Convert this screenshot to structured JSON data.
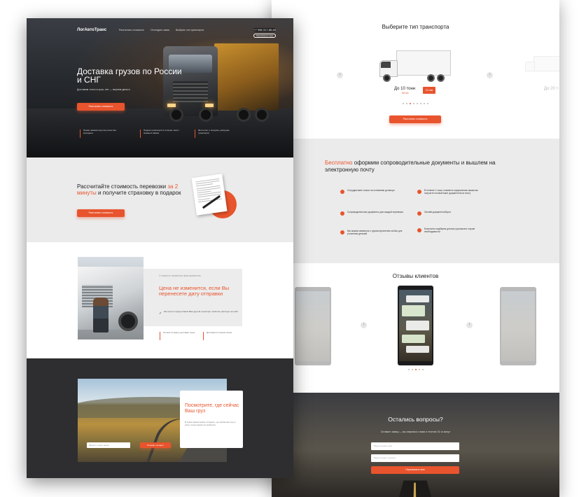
{
  "left_page": {
    "hero": {
      "logo": "ЛогАвтоТранс",
      "nav": [
        "Рассчитать стоимость",
        "Отследить заказ",
        "Выбрать тип транспорта"
      ],
      "phone": "+7 958 317-85-60",
      "callback": "Перезвоните мне",
      "title": "Доставка грузов по России и СНГ",
      "subtitle": "Доставим точно в срок, нет — вернем деньги",
      "cta": "Рассчитать стоимость",
      "features": [
        "Прием заказов круглосуточно без выходных",
        "Подача транспорта в течение часа с момента заказа",
        "Фотоотчет о погрузке, разгрузке транспорта"
      ]
    },
    "calc": {
      "title_part1": "Рассчитайте стоимость перевозки ",
      "title_highlight": "за 2 минуты",
      "title_part2": " и получите страховку в подарок",
      "cta": "Рассчитать стоимость"
    },
    "price": {
      "small": "Стоимость перевозки фиксированная",
      "title": "Цена не изменится, если Вы перенесете дату отправки",
      "note": "Мы просто предоставим Вам другой транспорт, взяв все расходы на себя",
      "features": [
        "Оплата по факту доставки груза",
        "Доставка в течение срока"
      ]
    },
    "tracking": {
      "title": "Посмотрите, где сейчас Ваш груз",
      "text": "В любое время можно отследить, где сейчас ваш груз и знать точное время его прибытия.",
      "input_placeholder": "Введите номер заказа",
      "cta": "Показать на карте"
    }
  },
  "right_page": {
    "transport": {
      "title": "Выберите тип транспорта",
      "capacity": "До 10 тонн",
      "volume": "55 м3",
      "badge": "20 т/км",
      "ghost_capacity": "До 20 т",
      "cta": "Рассчитать стоимость",
      "dots_count": 8,
      "active_dot": 2
    },
    "docs": {
      "title_highlight": "Бесплатно",
      "title_rest": " оформим сопроводительные документы и вышлем на электронную почту",
      "items": [
        "Сотрудничаем только на основании договора",
        "Сопроводительные документы для каждой перевозки",
        "Мы можем связаться с грузополучателем за Вас для уточнения деталей",
        "В течение 1 часа с момента оформления заказа вы получите полный пакет документов на почту",
        "Онлайн документооборот",
        "Бесплатно подберем для вас грузчиков в случае необходимости"
      ]
    },
    "reviews": {
      "title": "Отзывы клиентов",
      "dots_count": 5,
      "active_dot": 2
    },
    "questions": {
      "title": "Остались вопросы?",
      "subtitle": "Оставьте заявку — мы свяжемся с вами в течение 15-ти минут",
      "name_placeholder": "Введите ваше имя",
      "phone_placeholder": "Введите ваш телефон",
      "cta": "Перезвоните мне"
    }
  },
  "colors": {
    "accent": "#e8542d",
    "dark": "#2e2e30",
    "light_bg": "#ebebeb"
  }
}
